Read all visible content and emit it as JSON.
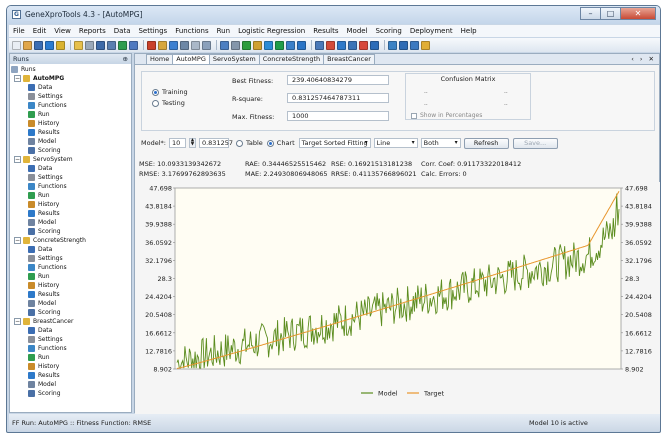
{
  "window": {
    "title": "GeneXproTools 4.3 - [AutoMPG]",
    "icon_letter": "G",
    "minimize": "–",
    "maximize": "□",
    "close": "✕"
  },
  "menu": [
    "File",
    "Edit",
    "View",
    "Reports",
    "Data",
    "Settings",
    "Functions",
    "Run",
    "Logistic Regression",
    "Results",
    "Model",
    "Scoring",
    "Deployment",
    "Help"
  ],
  "left_panel": {
    "header": "Runs",
    "pin": "⊕",
    "tree": {
      "root": "Runs",
      "projects": [
        {
          "name": "AutoMPG",
          "bold": true,
          "items": [
            "Data",
            "Settings",
            "Functions",
            "Run",
            "History",
            "Results",
            "Model",
            "Scoring"
          ]
        },
        {
          "name": "ServoSystem",
          "bold": false,
          "items": [
            "Data",
            "Settings",
            "Functions",
            "Run",
            "History",
            "Results",
            "Model",
            "Scoring"
          ]
        },
        {
          "name": "ConcreteStrength",
          "bold": false,
          "items": [
            "Data",
            "Settings",
            "Functions",
            "Run",
            "History",
            "Results",
            "Model",
            "Scoring"
          ]
        },
        {
          "name": "BreastCancer",
          "bold": false,
          "items": [
            "Data",
            "Settings",
            "Functions",
            "Run",
            "History",
            "Results",
            "Model",
            "Scoring"
          ]
        }
      ]
    }
  },
  "tabs": [
    "Home",
    "AutoMPG",
    "ServoSystem",
    "ConcreteStrength",
    "BreastCancer"
  ],
  "tab_arrows": "‹ › ✕",
  "fitness": {
    "training_label": "Training",
    "testing_label": "Testing",
    "best_fitness_label": "Best Fitness:",
    "best_fitness_value": "239.40640834279",
    "r_square_label": "R-square:",
    "r_square_value": "0.831257464787311",
    "max_fitness_label": "Max. Fitness:",
    "max_fitness_value": "1000"
  },
  "confusion_matrix": {
    "title": "Confusion Matrix",
    "cells": [
      "..",
      "..",
      "..",
      ".."
    ],
    "show_percentages": "Show in Percentages"
  },
  "chart_controls": {
    "model_label": "Model*:",
    "model_value": "10",
    "spin_up": "▲",
    "spin_down": "▼",
    "threshold": "0.831257",
    "table_label": "Table",
    "chart_label": "Chart",
    "sort_value": "Target Sorted Fitting",
    "line_value": "Line",
    "both_value": "Both",
    "refresh": "Refresh",
    "save": "Save..."
  },
  "stats": {
    "mse": "MSE:  10.0933139342672",
    "rmse": "RMSE: 3.17699762893635",
    "rae": "RAE:  0.34446525515462",
    "mae": "MAE:  2.24930806948065",
    "rse": "RSE:  0.16921513181238",
    "rrse": "RRSE: 0.41135766896021",
    "corr": "Corr. Coef:   0.91173322018412",
    "calc": "Calc. Errors:  0"
  },
  "chart_data": {
    "type": "line",
    "y_ticks": [
      "47.698",
      "43.8184",
      "39.9388",
      "36.0592",
      "32.1796",
      "28.3",
      "24.4204",
      "20.5408",
      "16.6612",
      "12.7816",
      "8.902"
    ],
    "ylim": [
      8.902,
      47.698
    ],
    "n_points": 392,
    "legend_placement": "bottom-center",
    "colors": {
      "model": "#5b8c1e",
      "target": "#e8962d",
      "background": "#fffdf3"
    },
    "series": [
      {
        "name": "Model"
      },
      {
        "name": "Target"
      }
    ]
  },
  "status": {
    "left": "FF Run: AutoMPG :: Fitness Function: RMSE",
    "right": "Model 10 is active"
  }
}
